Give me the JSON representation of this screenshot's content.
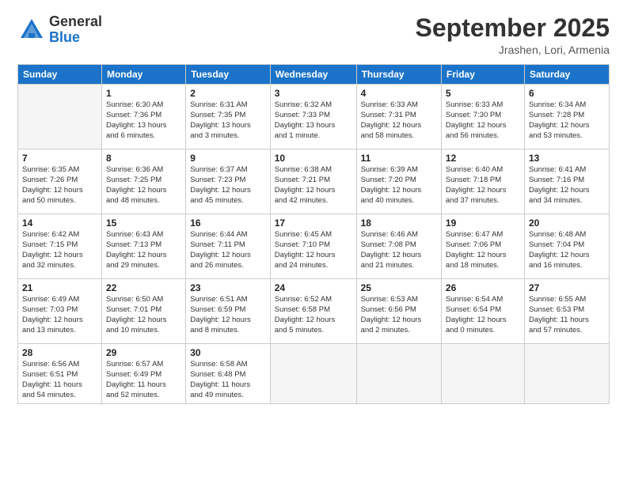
{
  "logo": {
    "general": "General",
    "blue": "Blue"
  },
  "header": {
    "month": "September 2025",
    "location": "Jrashen, Lori, Armenia"
  },
  "weekdays": [
    "Sunday",
    "Monday",
    "Tuesday",
    "Wednesday",
    "Thursday",
    "Friday",
    "Saturday"
  ],
  "weeks": [
    [
      {
        "day": "",
        "info": ""
      },
      {
        "day": "1",
        "info": "Sunrise: 6:30 AM\nSunset: 7:36 PM\nDaylight: 13 hours\nand 6 minutes."
      },
      {
        "day": "2",
        "info": "Sunrise: 6:31 AM\nSunset: 7:35 PM\nDaylight: 13 hours\nand 3 minutes."
      },
      {
        "day": "3",
        "info": "Sunrise: 6:32 AM\nSunset: 7:33 PM\nDaylight: 13 hours\nand 1 minute."
      },
      {
        "day": "4",
        "info": "Sunrise: 6:33 AM\nSunset: 7:31 PM\nDaylight: 12 hours\nand 58 minutes."
      },
      {
        "day": "5",
        "info": "Sunrise: 6:33 AM\nSunset: 7:30 PM\nDaylight: 12 hours\nand 56 minutes."
      },
      {
        "day": "6",
        "info": "Sunrise: 6:34 AM\nSunset: 7:28 PM\nDaylight: 12 hours\nand 53 minutes."
      }
    ],
    [
      {
        "day": "7",
        "info": "Sunrise: 6:35 AM\nSunset: 7:26 PM\nDaylight: 12 hours\nand 50 minutes."
      },
      {
        "day": "8",
        "info": "Sunrise: 6:36 AM\nSunset: 7:25 PM\nDaylight: 12 hours\nand 48 minutes."
      },
      {
        "day": "9",
        "info": "Sunrise: 6:37 AM\nSunset: 7:23 PM\nDaylight: 12 hours\nand 45 minutes."
      },
      {
        "day": "10",
        "info": "Sunrise: 6:38 AM\nSunset: 7:21 PM\nDaylight: 12 hours\nand 42 minutes."
      },
      {
        "day": "11",
        "info": "Sunrise: 6:39 AM\nSunset: 7:20 PM\nDaylight: 12 hours\nand 40 minutes."
      },
      {
        "day": "12",
        "info": "Sunrise: 6:40 AM\nSunset: 7:18 PM\nDaylight: 12 hours\nand 37 minutes."
      },
      {
        "day": "13",
        "info": "Sunrise: 6:41 AM\nSunset: 7:16 PM\nDaylight: 12 hours\nand 34 minutes."
      }
    ],
    [
      {
        "day": "14",
        "info": "Sunrise: 6:42 AM\nSunset: 7:15 PM\nDaylight: 12 hours\nand 32 minutes."
      },
      {
        "day": "15",
        "info": "Sunrise: 6:43 AM\nSunset: 7:13 PM\nDaylight: 12 hours\nand 29 minutes."
      },
      {
        "day": "16",
        "info": "Sunrise: 6:44 AM\nSunset: 7:11 PM\nDaylight: 12 hours\nand 26 minutes."
      },
      {
        "day": "17",
        "info": "Sunrise: 6:45 AM\nSunset: 7:10 PM\nDaylight: 12 hours\nand 24 minutes."
      },
      {
        "day": "18",
        "info": "Sunrise: 6:46 AM\nSunset: 7:08 PM\nDaylight: 12 hours\nand 21 minutes."
      },
      {
        "day": "19",
        "info": "Sunrise: 6:47 AM\nSunset: 7:06 PM\nDaylight: 12 hours\nand 18 minutes."
      },
      {
        "day": "20",
        "info": "Sunrise: 6:48 AM\nSunset: 7:04 PM\nDaylight: 12 hours\nand 16 minutes."
      }
    ],
    [
      {
        "day": "21",
        "info": "Sunrise: 6:49 AM\nSunset: 7:03 PM\nDaylight: 12 hours\nand 13 minutes."
      },
      {
        "day": "22",
        "info": "Sunrise: 6:50 AM\nSunset: 7:01 PM\nDaylight: 12 hours\nand 10 minutes."
      },
      {
        "day": "23",
        "info": "Sunrise: 6:51 AM\nSunset: 6:59 PM\nDaylight: 12 hours\nand 8 minutes."
      },
      {
        "day": "24",
        "info": "Sunrise: 6:52 AM\nSunset: 6:58 PM\nDaylight: 12 hours\nand 5 minutes."
      },
      {
        "day": "25",
        "info": "Sunrise: 6:53 AM\nSunset: 6:56 PM\nDaylight: 12 hours\nand 2 minutes."
      },
      {
        "day": "26",
        "info": "Sunrise: 6:54 AM\nSunset: 6:54 PM\nDaylight: 12 hours\nand 0 minutes."
      },
      {
        "day": "27",
        "info": "Sunrise: 6:55 AM\nSunset: 6:53 PM\nDaylight: 11 hours\nand 57 minutes."
      }
    ],
    [
      {
        "day": "28",
        "info": "Sunrise: 6:56 AM\nSunset: 6:51 PM\nDaylight: 11 hours\nand 54 minutes."
      },
      {
        "day": "29",
        "info": "Sunrise: 6:57 AM\nSunset: 6:49 PM\nDaylight: 11 hours\nand 52 minutes."
      },
      {
        "day": "30",
        "info": "Sunrise: 6:58 AM\nSunset: 6:48 PM\nDaylight: 11 hours\nand 49 minutes."
      },
      {
        "day": "",
        "info": ""
      },
      {
        "day": "",
        "info": ""
      },
      {
        "day": "",
        "info": ""
      },
      {
        "day": "",
        "info": ""
      }
    ]
  ]
}
